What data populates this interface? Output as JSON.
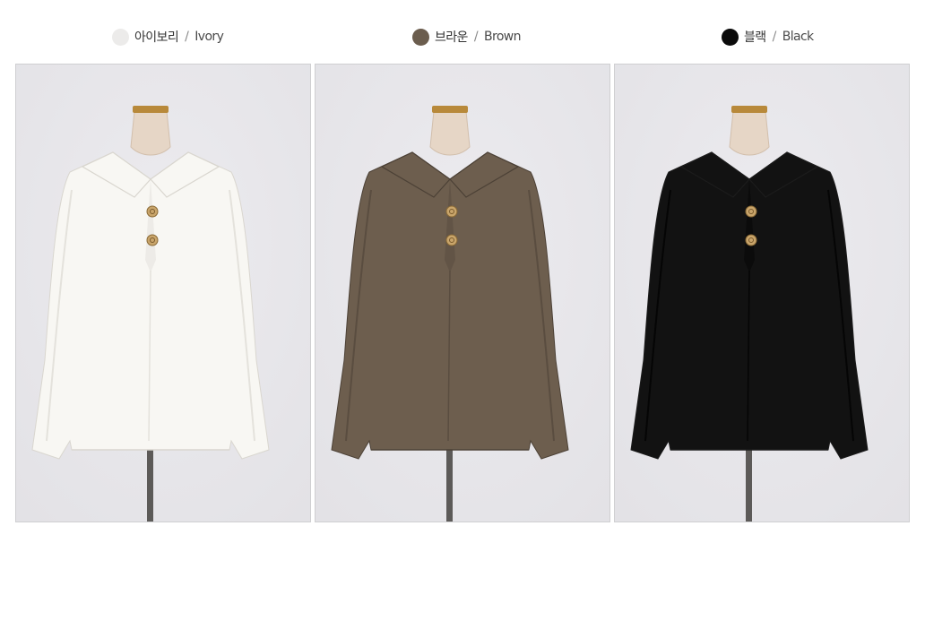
{
  "colors": [
    {
      "ko": "아이보리",
      "sep": "/",
      "en": "Ivory",
      "swatch": "#ecebea",
      "garment": "#f8f7f3",
      "shade": "#e4e2dc",
      "edge": "#d9d6cf"
    },
    {
      "ko": "브라운",
      "sep": "/",
      "en": "Brown",
      "swatch": "#6b5d4e",
      "garment": "#6d5e4e",
      "shade": "#5a4d40",
      "edge": "#4c4136"
    },
    {
      "ko": "블랙",
      "sep": "/",
      "en": "Black",
      "swatch": "#0b0b0b",
      "garment": "#121212",
      "shade": "#050505",
      "edge": "#1c1c1c"
    }
  ],
  "theme": {
    "backdrop": "#e3e2e6",
    "mannequin": "#e6d6c6",
    "mannequin_shadow": "#d2bfac",
    "stand": "#5c5a58",
    "gold": "#b8893a",
    "button_gold": "#c9a56b"
  }
}
